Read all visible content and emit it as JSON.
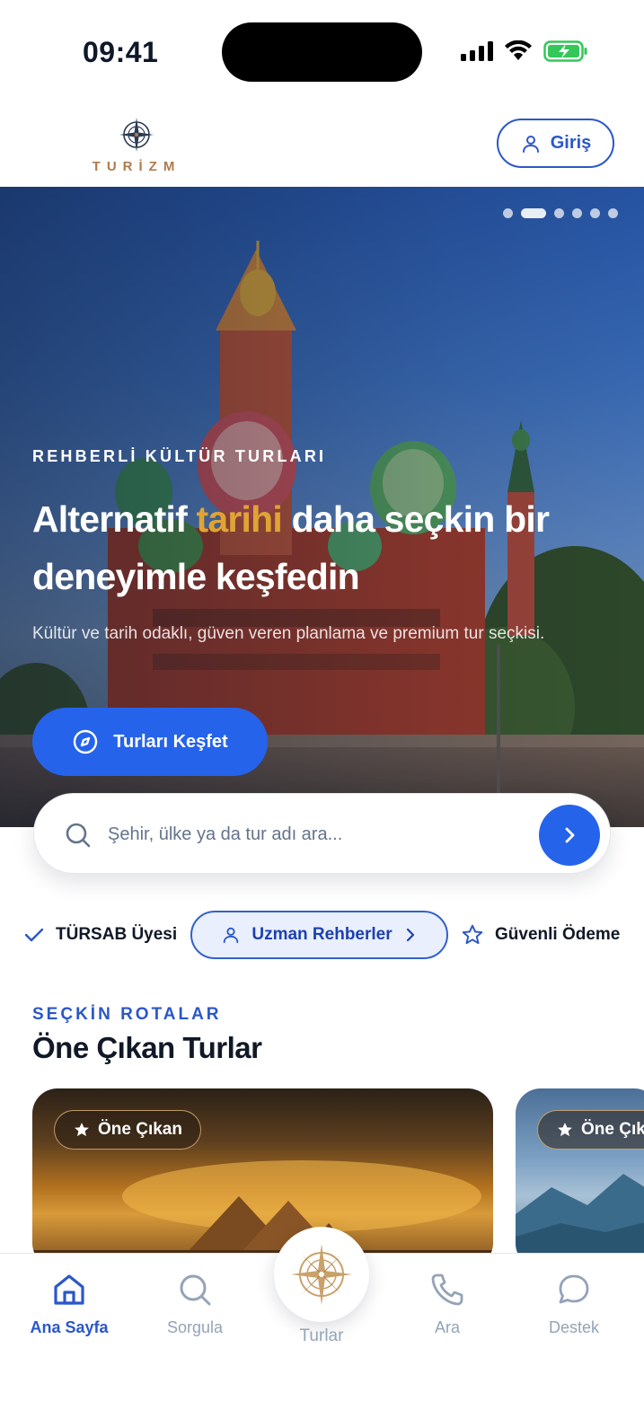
{
  "status_bar": {
    "time": "09:41"
  },
  "header": {
    "logo_text": "TURİZM",
    "login_label": "Giriş"
  },
  "hero": {
    "eyebrow": "REHBERLİ KÜLTÜR TURLARI",
    "title_part1": "Alternatif ",
    "title_highlight": "tarihi",
    "title_part2": " daha seçkin bir deneyimle keşfedin",
    "description": "Kültür ve tarih odaklı, güven veren planlama ve premium tur seçkisi.",
    "cta_label": "Turları Keşfet",
    "carousel_total": 6,
    "carousel_active_index": 1,
    "highlight_color": "#e0a435"
  },
  "search": {
    "placeholder": "Şehir, ülke ya da tur adı ara..."
  },
  "chips": {
    "tursab": "TÜRSAB Üyesi",
    "guides": "Uzman Rehberler",
    "payment": "Güvenli Ödeme"
  },
  "featured": {
    "eyebrow": "SEÇKİN ROTALAR",
    "title": "Öne Çıkan Turlar",
    "cards": [
      {
        "badge": "Öne Çıkan"
      },
      {
        "badge": "Öne Çıkan"
      }
    ]
  },
  "nav": {
    "home": "Ana Sayfa",
    "query": "Sorgula",
    "tours": "Turlar",
    "call": "Ara",
    "support": "Destek"
  },
  "colors": {
    "accent": "#2563eb",
    "brand_dark": "#2b57c9",
    "logo_gold": "#b07a4a"
  }
}
